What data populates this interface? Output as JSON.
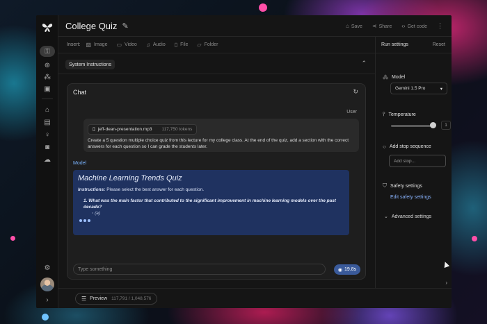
{
  "header": {
    "title": "College Quiz",
    "save_label": "Save",
    "share_label": "Share",
    "get_code_label": "Get code"
  },
  "insert_bar": {
    "label": "Insert:",
    "items": [
      "Image",
      "Video",
      "Audio",
      "File",
      "Folder"
    ]
  },
  "system_instructions": {
    "label": "System Instructions"
  },
  "chat": {
    "title": "Chat",
    "user_label": "User",
    "file": {
      "name": "jeff-dean-presentation.mp3",
      "tokens": "117,750 tokens"
    },
    "user_message": "Create a 5 question multiple choice quiz from this lecture for my college class. At the end of the quiz, add a section with the correct answers for each question so I can grade the students later.",
    "model_label": "Model",
    "response": {
      "title": "Machine Learning Trends Quiz",
      "instructions_label": "Instructions:",
      "instructions_text": "Please select the best answer for each question.",
      "question_1": "1. What was the main factor that contributed to the significant improvement in machine learning models over the past decade?",
      "option_a": "◦ (a)"
    },
    "input_placeholder": "Type something",
    "run_time": "19.8s"
  },
  "bottom": {
    "preview_label": "Preview",
    "token_count": "117,791 / 1,048,576"
  },
  "run_settings": {
    "title": "Run settings",
    "reset_label": "Reset",
    "model_label": "Model",
    "model_value": "Gemini 1.5 Pro",
    "temperature_label": "Temperature",
    "temperature_value": "1",
    "temperature_fraction": 0.95,
    "stop_sequence_label": "Add stop sequence",
    "stop_placeholder": "Add stop...",
    "safety_label": "Safety settings",
    "safety_link": "Edit safety settings",
    "advanced_label": "Advanced settings"
  },
  "colors": {
    "accent": "#8ab4ff",
    "model_card": "#1f3260",
    "run_button": "#3a5a9a"
  },
  "icons": {
    "rail": [
      "key-icon",
      "add-icon",
      "gallery-icon",
      "library-icon",
      "school-icon",
      "docs-icon",
      "lightbulb-icon",
      "discord-icon",
      "cloud-icon",
      "settings-icon"
    ]
  }
}
